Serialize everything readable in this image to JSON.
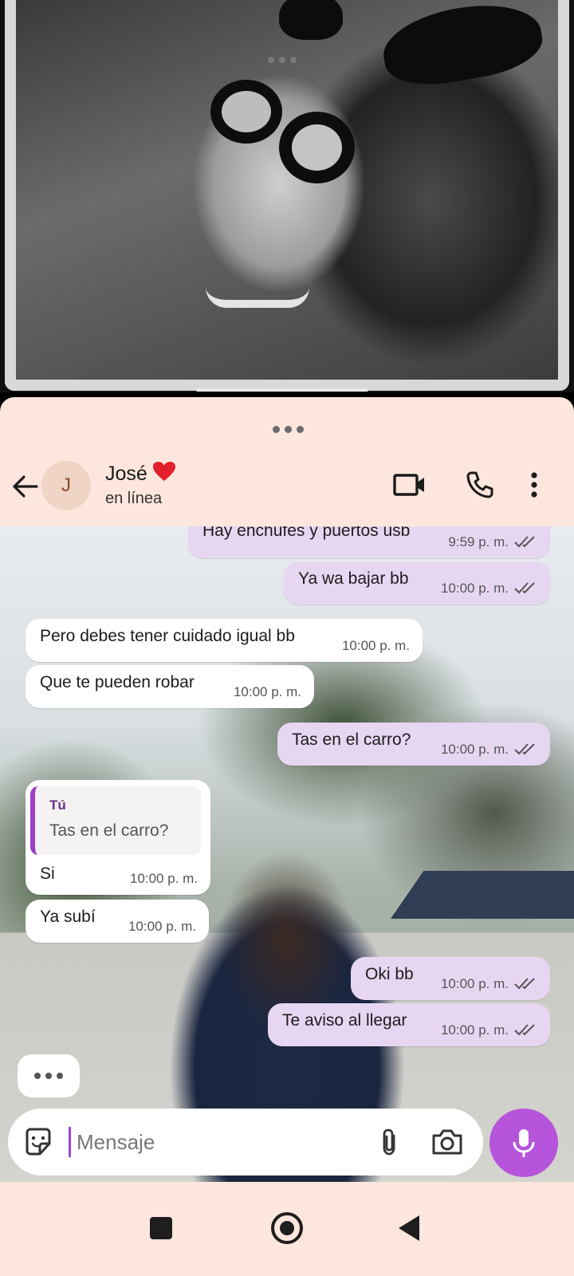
{
  "contact": {
    "avatar_letter": "J",
    "name": "José",
    "status": "en línea"
  },
  "messages": [
    {
      "direction": "out",
      "text": "Hay enchufes y puertos usb",
      "time": "9:59 p. m.",
      "read": true
    },
    {
      "direction": "out",
      "text": "Ya wa bajar bb",
      "time": "10:00 p. m.",
      "read": true
    },
    {
      "direction": "in",
      "text": "Pero debes tener cuidado igual bb",
      "time": "10:00 p. m."
    },
    {
      "direction": "in",
      "text": "Que te pueden robar",
      "time": "10:00 p. m."
    },
    {
      "direction": "out",
      "text": "Tas en el carro?",
      "time": "10:00 p. m.",
      "read": true
    },
    {
      "direction": "in",
      "text": "Si",
      "time": "10:00 p. m.",
      "quote": {
        "author": "Tú",
        "text": "Tas en el carro?"
      }
    },
    {
      "direction": "in",
      "text": "Ya subí",
      "time": "10:00 p. m."
    },
    {
      "direction": "out",
      "text": "Oki bb",
      "time": "10:00 p. m.",
      "read": true
    },
    {
      "direction": "out",
      "text": "Te aviso al llegar",
      "time": "10:00 p. m.",
      "read": true
    }
  ],
  "composer": {
    "placeholder": "Mensaje"
  },
  "icons": {
    "back": "arrow-left-icon",
    "video": "video-call-icon",
    "call": "phone-icon",
    "menu": "more-vert-icon",
    "sticker": "sticker-icon",
    "attach": "paperclip-icon",
    "camera": "camera-icon",
    "mic": "mic-icon",
    "heart": "red-heart-icon"
  },
  "colors": {
    "sheet_background": "#fde6dd",
    "outgoing_bubble": "#e7d6f2",
    "incoming_bubble": "#ffffff",
    "accent": "#b654db"
  }
}
